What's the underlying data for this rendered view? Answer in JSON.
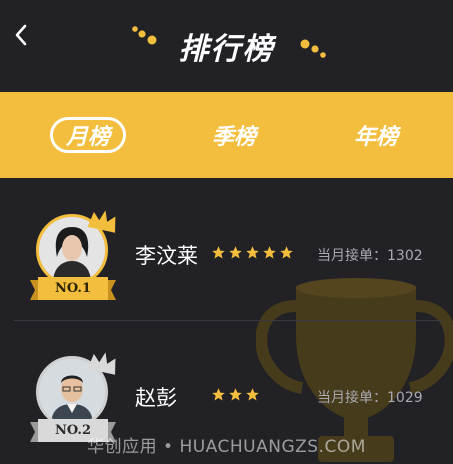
{
  "header": {
    "title": "排行榜"
  },
  "tabs": [
    {
      "label": "月榜",
      "active": true
    },
    {
      "label": "季榜",
      "active": false
    },
    {
      "label": "年榜",
      "active": false
    }
  ],
  "ranking": [
    {
      "rank_badge": "NO.1",
      "name": "李汶莱",
      "stars": 5,
      "meta": "当月接单：1302"
    },
    {
      "rank_badge": "NO.2",
      "name": "赵彭",
      "stars": 3,
      "meta": "当月接单：1029"
    }
  ],
  "watermark": "华创应用 • HUACHUANGZS.COM",
  "colors": {
    "accent": "#f3be3d",
    "background": "#222126",
    "trophy": "#4b3e1a"
  }
}
